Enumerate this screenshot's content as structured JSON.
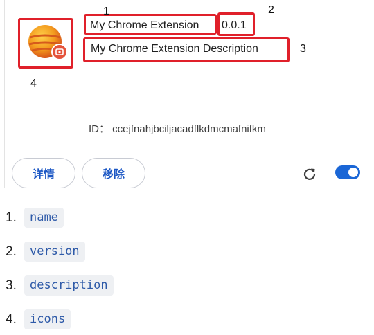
{
  "extension": {
    "name": "My Chrome Extension",
    "version": "0.0.1",
    "description": "My Chrome Extension Description",
    "id_text": "ID： ccejfnahjbciljacadflkdmcmafnifkm"
  },
  "buttons": {
    "details_label": "详情",
    "remove_label": "移除"
  },
  "toggle": {
    "enabled": true
  },
  "annotations": {
    "n1": "1",
    "n2": "2",
    "n3": "3",
    "n4": "4"
  },
  "list": [
    {
      "num": "1.",
      "field": "name"
    },
    {
      "num": "2.",
      "field": "version"
    },
    {
      "num": "3.",
      "field": "description"
    },
    {
      "num": "4.",
      "field": "icons"
    }
  ],
  "colors": {
    "highlight": "#e0202a",
    "accent": "#1a66d6"
  }
}
